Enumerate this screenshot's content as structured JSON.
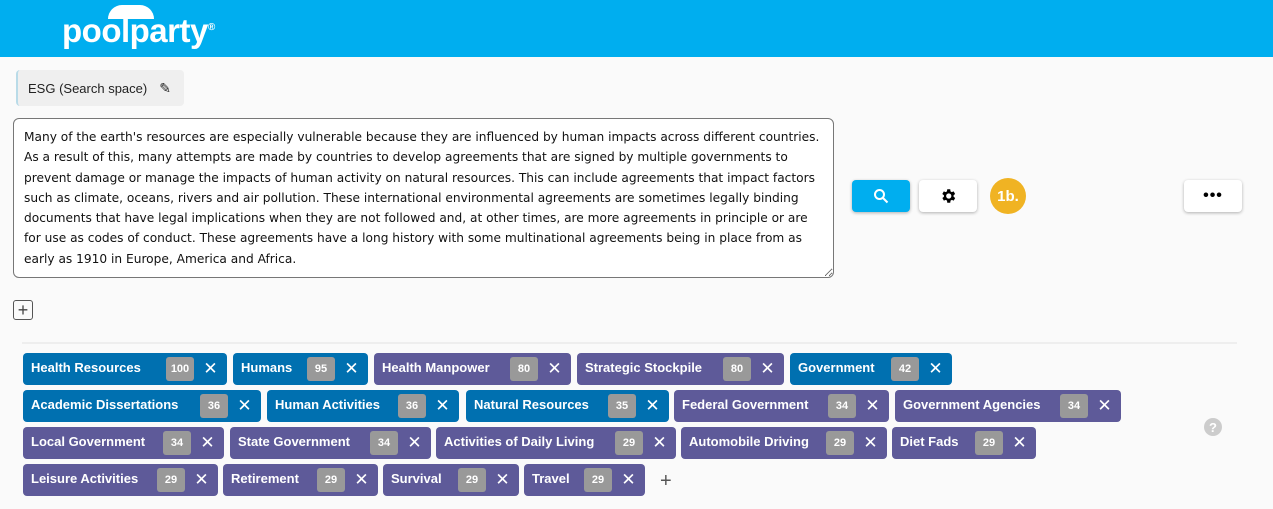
{
  "header": {
    "logo": "poolparty",
    "logo_mark": "®"
  },
  "search_space": {
    "label": "ESG (Search space)"
  },
  "query": {
    "text": "Many of the earth's resources are especially vulnerable because they are influenced by human impacts across different countries. As a result of this, many attempts are made by countries to develop agreements that are signed by multiple governments to prevent damage or manage the impacts of human activity on natural resources. This can include agreements that impact factors such as climate, oceans, rivers and air pollution. These international environmental agreements are sometimes legally binding documents that have legal implications when they are not followed and, at other times, are more agreements in principle or are for use as codes of conduct. These agreements have a long history with some multinational agreements being in place from as early as 1910 in Europe, America and Africa."
  },
  "toolbar": {
    "step_badge": "1b.",
    "search_icon": "search-icon",
    "settings_icon": "gear-icon",
    "more_icon": "more-icon"
  },
  "colors": {
    "header": "#00aeef",
    "blue_tag": "#0070b0",
    "purple_tag": "#5e5a99",
    "step_badge": "#f0b323"
  },
  "tags": [
    {
      "label": "Health Resources",
      "count": "100",
      "color": "blue"
    },
    {
      "label": "Humans",
      "count": "95",
      "color": "blue"
    },
    {
      "label": "Health Manpower",
      "count": "80",
      "color": "purple"
    },
    {
      "label": "Strategic Stockpile",
      "count": "80",
      "color": "purple"
    },
    {
      "label": "Government",
      "count": "42",
      "color": "blue"
    },
    {
      "label": "Academic Dissertations",
      "count": "36",
      "color": "blue"
    },
    {
      "label": "Human Activities",
      "count": "36",
      "color": "blue"
    },
    {
      "label": "Natural Resources",
      "count": "35",
      "color": "blue"
    },
    {
      "label": "Federal Government",
      "count": "34",
      "color": "purple"
    },
    {
      "label": "Government Agencies",
      "count": "34",
      "color": "purple"
    },
    {
      "label": "Local Government",
      "count": "34",
      "color": "purple"
    },
    {
      "label": "State Government",
      "count": "34",
      "color": "purple"
    },
    {
      "label": "Activities of Daily Living",
      "count": "29",
      "color": "purple"
    },
    {
      "label": "Automobile Driving",
      "count": "29",
      "color": "purple"
    },
    {
      "label": "Diet Fads",
      "count": "29",
      "color": "purple"
    },
    {
      "label": "Leisure Activities",
      "count": "29",
      "color": "purple"
    },
    {
      "label": "Retirement",
      "count": "29",
      "color": "purple"
    },
    {
      "label": "Survival",
      "count": "29",
      "color": "purple"
    },
    {
      "label": "Travel",
      "count": "29",
      "color": "purple"
    }
  ],
  "help": "?"
}
